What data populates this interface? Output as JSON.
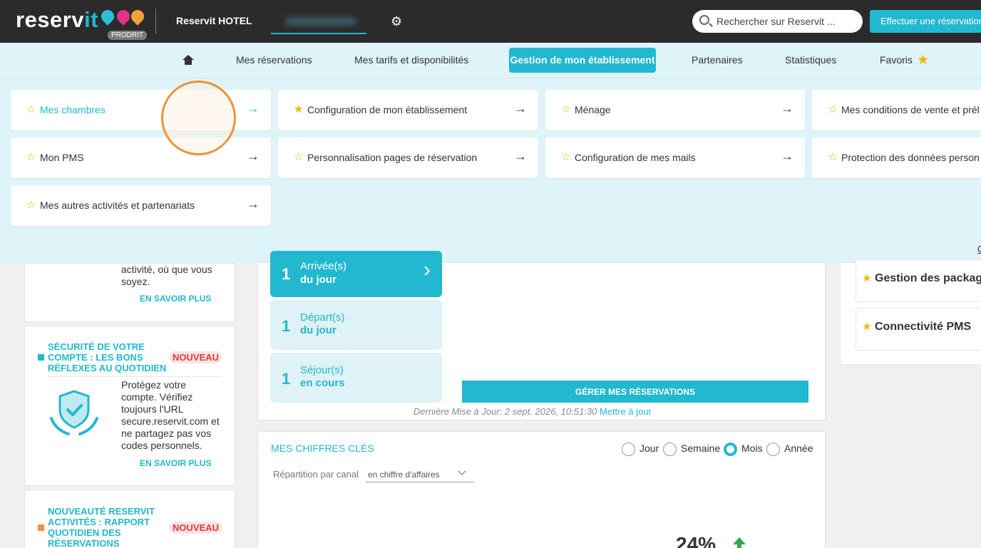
{
  "topbar": {
    "logo_main": "reserv",
    "logo_accent": "it",
    "badge": "PRODRIT",
    "hotel_name": "Reservit HOTEL",
    "search_placeholder": "Rechercher sur Reservit ...",
    "book_button": "Effectuer une réservation",
    "icons": [
      "gear-icon",
      "search-icon"
    ]
  },
  "nav": {
    "items": [
      "Mes réservations",
      "Mes tarifs et disponibilités",
      "Gestion de mon établissement",
      "Partenaires",
      "Statistiques",
      "Favoris"
    ],
    "active": "Gestion de mon établissement"
  },
  "mega": {
    "cards": [
      {
        "label": "Mes chambres"
      },
      {
        "label": "Configuration de mon établissement"
      },
      {
        "label": "Ménage"
      },
      {
        "label": "Mes conditions de vente et prél"
      },
      {
        "label": "Mon PMS"
      },
      {
        "label": "Personnalisation pages de réservation"
      },
      {
        "label": "Configuration de mes mails"
      },
      {
        "label": "Protection des données person"
      },
      {
        "label": "Mes autres activités et partenariats"
      }
    ],
    "clipped_link": "C"
  },
  "left": {
    "panel1": {
      "text": [
        "activité, où que vous",
        "soyez."
      ],
      "link": "EN SAVOIR PLUS"
    },
    "panel2": {
      "title": [
        "SÉCURITÉ DE VOTRE",
        "COMPTE : LES BONS",
        "RÉFLEXES AU QUOTIDIEN"
      ],
      "badge": "NOUVEAU",
      "text": [
        "Protégez votre",
        "compte. Vérifiez",
        "toujours l'URL",
        "secure.reservit.com et",
        "ne partagez pas vos",
        "codes personnels."
      ],
      "link": "EN SAVOIR PLUS"
    },
    "panel3": {
      "title": [
        "NOUVEAUTÉ RESERVIT",
        "ACTIVITÉS : RAPPORT",
        "QUOTIDIEN DES",
        "RÉSERVATIONS"
      ],
      "badge": "NOUVEAU"
    },
    "colors": {
      "cyan": "#22b8cf",
      "orange": "#f0913a",
      "red": "#e23b3b"
    }
  },
  "reservations": {
    "tiles": [
      {
        "count": "1",
        "line1": "Arrivée(s)",
        "line2": "du jour"
      },
      {
        "count": "1",
        "line1": "Départ(s)",
        "line2": "du jour"
      },
      {
        "count": "1",
        "line1": "Séjour(s)",
        "line2": "en cours"
      }
    ],
    "manage_button": "GÉRER MES RÉSERVATIONS",
    "last_update": "Dernière Mise à Jour: 2 sept. 2026, 10:51:30",
    "update_link": "Mettre à jour"
  },
  "key_figures": {
    "title": "MES CHIFFRES CLÉS",
    "periods": [
      "Jour",
      "Semaine",
      "Mois",
      "Année"
    ],
    "selected_period": "Mois",
    "breakdown_label": "Répartition par canal",
    "breakdown_select": "en chiffre d'affaires",
    "percentage": "24%"
  },
  "right": {
    "items": [
      "Gestion des package",
      "Connectivité PMS"
    ]
  }
}
